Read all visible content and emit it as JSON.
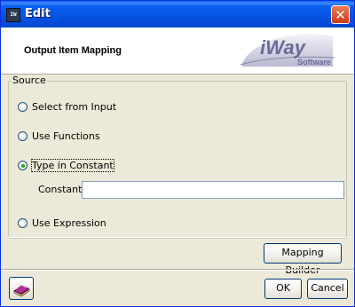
{
  "window": {
    "title": "Edit",
    "app_icon_text": "IW",
    "close_glyph": "✕"
  },
  "header": {
    "title": "Output Item Mapping",
    "logo": {
      "brand": "iWay",
      "tagline": "Software"
    }
  },
  "source_group": {
    "legend": "Source",
    "options": [
      {
        "label": "Select from Input",
        "checked": false
      },
      {
        "label": "Use Functions",
        "checked": false
      },
      {
        "label": "Type in Constant",
        "checked": true
      },
      {
        "label": "Use Expression",
        "checked": false
      }
    ],
    "constant": {
      "label": "Constant:",
      "value": ""
    }
  },
  "buttons": {
    "mapping_builder": "Mapping Builder",
    "ok": "OK",
    "cancel": "Cancel",
    "help_icon": "book-icon"
  },
  "colors": {
    "titlebar": "#0a5ff0",
    "dialog_bg": "#ece9d8",
    "radio_dot": "#27a327",
    "logo_purple": "#6a6a9a"
  }
}
